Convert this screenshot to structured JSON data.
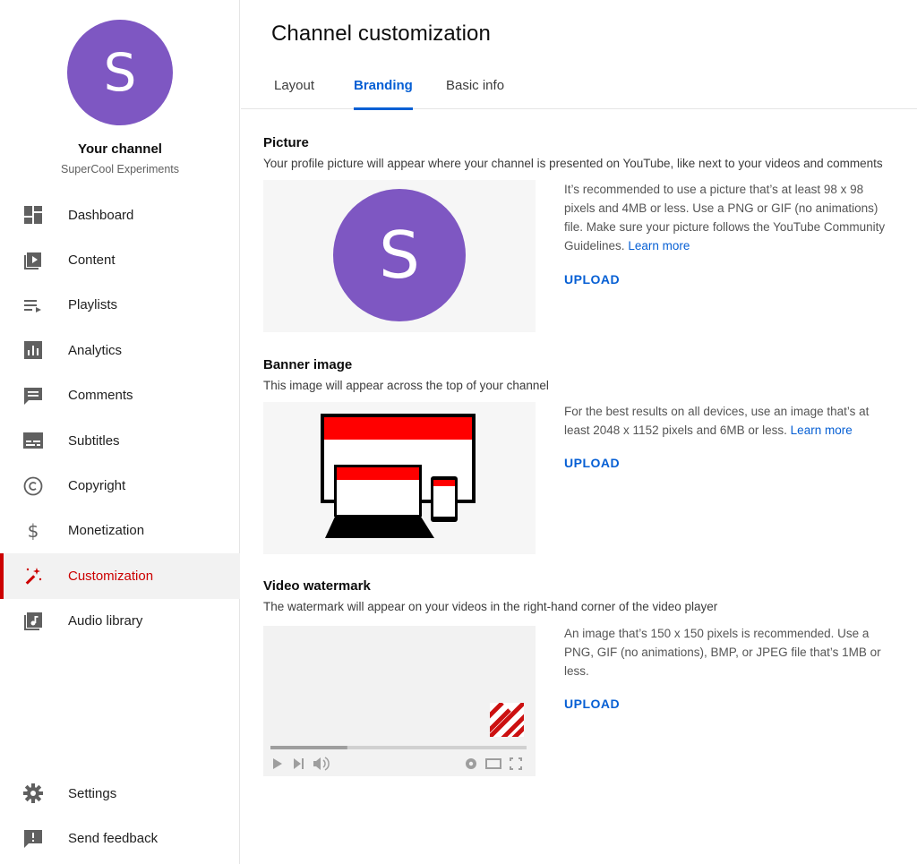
{
  "channel": {
    "avatar_letter": "S",
    "title": "Your channel",
    "name": "SuperCool Experiments"
  },
  "sidebar": {
    "items": [
      {
        "label": "Dashboard",
        "icon": "dashboard-icon"
      },
      {
        "label": "Content",
        "icon": "content-icon"
      },
      {
        "label": "Playlists",
        "icon": "playlists-icon"
      },
      {
        "label": "Analytics",
        "icon": "analytics-icon"
      },
      {
        "label": "Comments",
        "icon": "comments-icon"
      },
      {
        "label": "Subtitles",
        "icon": "subtitles-icon"
      },
      {
        "label": "Copyright",
        "icon": "copyright-icon"
      },
      {
        "label": "Monetization",
        "icon": "dollar-icon"
      },
      {
        "label": "Customization",
        "icon": "magic-wand-icon",
        "active": true
      },
      {
        "label": "Audio library",
        "icon": "audio-library-icon"
      }
    ],
    "bottom": [
      {
        "label": "Settings",
        "icon": "gear-icon"
      },
      {
        "label": "Send feedback",
        "icon": "feedback-icon"
      }
    ]
  },
  "page": {
    "title": "Channel customization",
    "tabs": [
      {
        "label": "Layout"
      },
      {
        "label": "Branding",
        "active": true
      },
      {
        "label": "Basic info"
      }
    ]
  },
  "picture": {
    "title": "Picture",
    "description": "Your profile picture will appear where your channel is presented on YouTube, like next to your videos and comments",
    "info": "It’s recommended to use a picture that’s at least 98 x 98 pixels and 4MB or less. Use a PNG or GIF (no animations) file. Make sure your picture follows the YouTube Community Guidelines.",
    "learn_more": "Learn more",
    "upload": "UPLOAD"
  },
  "banner": {
    "title": "Banner image",
    "description": "This image will appear across the top of your channel",
    "info": "For the best results on all devices, use an image that’s at least 2048 x 1152 pixels and 6MB or less.",
    "learn_more": "Learn more",
    "upload": "UPLOAD"
  },
  "watermark": {
    "title": "Video watermark",
    "description": "The watermark will appear on your videos in the right-hand corner of the video player",
    "info": "An image that’s 150 x 150 pixels is recommended. Use a PNG, GIF (no animations), BMP, or JPEG file that’s 1MB or less.",
    "upload": "UPLOAD",
    "player_progress": 0.3
  },
  "colors": {
    "accent": "#065fd4",
    "active": "#cc0000",
    "avatar": "#7e57c2"
  }
}
